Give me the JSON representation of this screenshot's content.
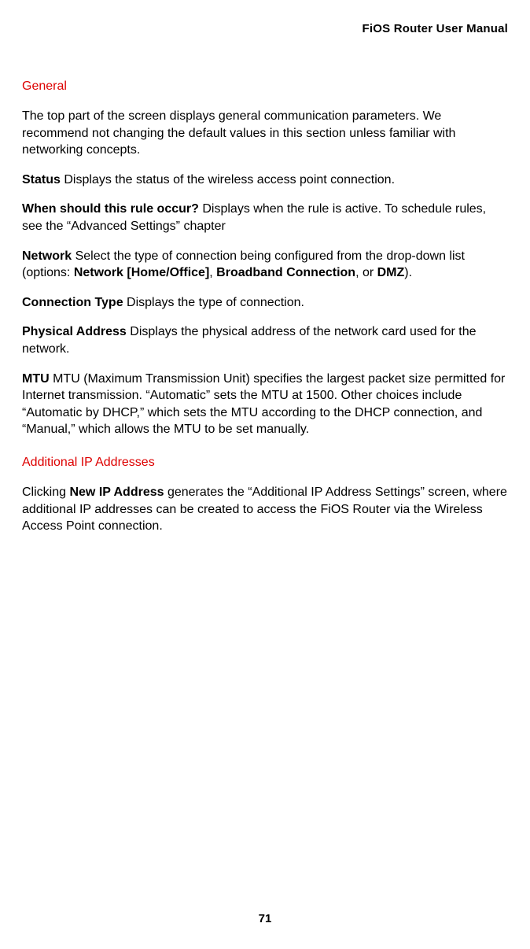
{
  "header": {
    "title": "FiOS Router User Manual"
  },
  "sections": {
    "general": {
      "heading": "General",
      "intro": "The top part of the screen displays general communication parameters. We recommend not changing the default values in this section unless familiar with networking concepts.",
      "status_label": "Status",
      "status_text": "  Displays the status of the wireless access point connection.",
      "when_label": "When should this rule occur?",
      "when_text": "  Displays when the rule is active. To schedule rules, see the “Advanced Settings” chapter",
      "network_label": "Network",
      "network_text_1": "  Select the type of connection being configured from the drop-down list (options: ",
      "network_bold_1": "Network [Home/Office]",
      "network_text_2": ", ",
      "network_bold_2": "Broadband Connection",
      "network_text_3": ", or ",
      "network_bold_3": "DMZ",
      "network_text_4": ").",
      "conntype_label": "Connection Type",
      "conntype_text": "  Displays the type of connection.",
      "physaddr_label": "Physical Address",
      "physaddr_text": "  Displays the physical address of the network card used for the network.",
      "mtu_label": "MTU",
      "mtu_text": "  MTU (Maximum Transmission Unit) specifies the largest packet size permitted for Internet transmission. “Automatic” sets the MTU at 1500. Other choices include “Automatic by DHCP,” which sets the MTU according to the DHCP connection, and “Manual,” which allows the MTU to be set manually."
    },
    "additional_ip": {
      "heading": "Additional IP Addresses",
      "text_1": "Clicking ",
      "bold_1": "New IP Address",
      "text_2": " generates the “Additional IP Address Settings” screen, where additional IP addresses can be created to access the FiOS Router via the Wireless Access Point connection."
    }
  },
  "page_number": "71"
}
